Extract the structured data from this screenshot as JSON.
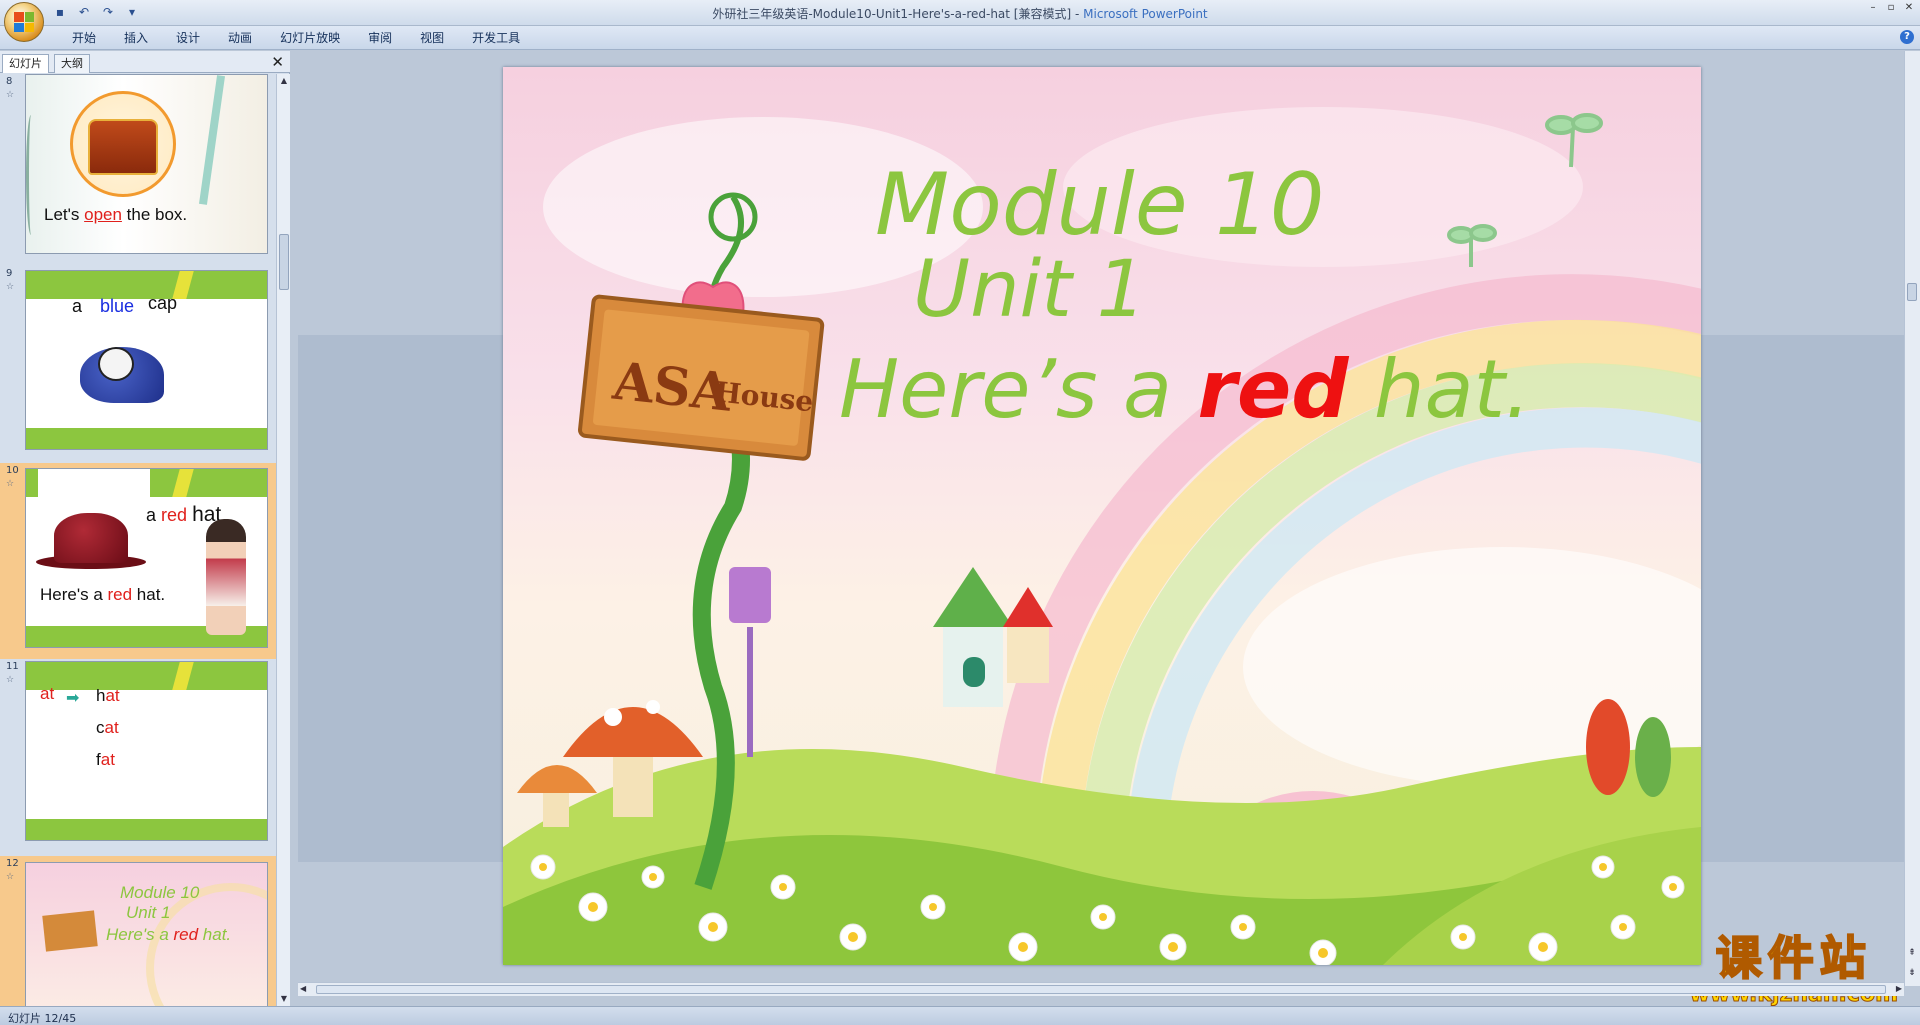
{
  "window": {
    "title_doc": "外研社三年级英语-Module10-Unit1-Here's-a-red-hat [兼容模式] - ",
    "title_app": "Microsoft PowerPoint",
    "controls": [
      "–",
      "▫",
      "✕"
    ]
  },
  "ribbon": {
    "tabs": [
      "开始",
      "插入",
      "设计",
      "动画",
      "幻灯片放映",
      "审阅",
      "视图",
      "开发工具"
    ],
    "help": "?"
  },
  "panel": {
    "tab_slides": "幻灯片",
    "tab_outline": "大纲",
    "close": "✕"
  },
  "thumbnails": [
    {
      "num": "8",
      "text_a": "Let's ",
      "text_b": "open",
      "text_c": " the box."
    },
    {
      "num": "9",
      "w1": "a",
      "w2": "blue",
      "w3": "cap"
    },
    {
      "num": "10",
      "w1": "a",
      "w2": "red",
      "w3": "hat",
      "s1": "Here's a ",
      "s2": "red",
      "s3": " hat."
    },
    {
      "num": "11",
      "a": "at",
      "l1a": "h",
      "l1b": "at",
      "l2a": "c",
      "l2b": "at",
      "l3a": "f",
      "l3b": "at"
    },
    {
      "num": "12",
      "t1": "Module 10",
      "t2": "Unit 1",
      "t3a": "Here's a ",
      "t3b": "red",
      "t3c": " hat."
    }
  ],
  "slide": {
    "line1": "Module 10",
    "line2": "Unit 1",
    "line3a": "Here’s a ",
    "line3b": "red",
    "line3c": " hat.",
    "sign": "ASA",
    "sign2": "House"
  },
  "watermark": {
    "big": "课件站",
    "small": "www.kjzhan.com"
  },
  "status": {
    "text": "幻灯片 12/45"
  }
}
